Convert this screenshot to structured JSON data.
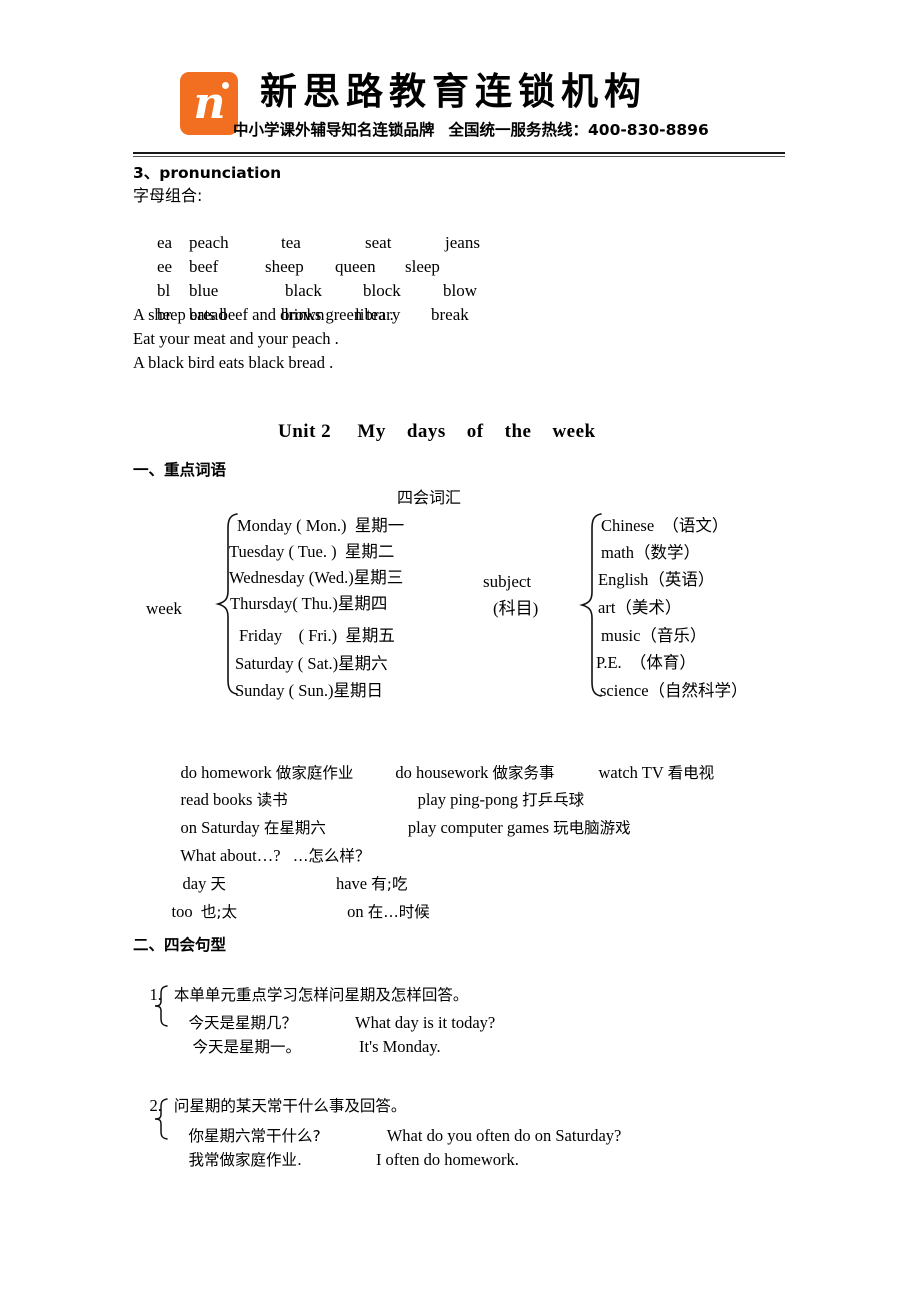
{
  "header": {
    "logo_icon": "script-n-logo-icon",
    "logo_letter": "n",
    "brand_title": "新思路教育连锁机构",
    "brand_sub_left": "中小学课外辅导知名连锁品牌",
    "brand_sub_right": "全国统一服务热线：400-830-8896"
  },
  "pronunciation": {
    "heading": "3、pronunciation",
    "subheading": "字母组合:",
    "rows": [
      {
        "combo": "ea",
        "words": [
          "peach",
          "tea",
          "seat",
          "jeans"
        ]
      },
      {
        "combo": "ee",
        "words": [
          "beef",
          "sheep",
          "queen",
          "sleep"
        ]
      },
      {
        "combo": "bl",
        "words": [
          "blue",
          "black",
          "block",
          "blow"
        ]
      },
      {
        "combo": "br",
        "words": [
          "bread",
          "brown",
          "library",
          "break"
        ]
      }
    ],
    "sentences": [
      "A sheep eats beef and drinks green tea .",
      "Eat your meat and your peach .",
      "A black bird eats black bread ."
    ]
  },
  "unit": {
    "title": "Unit 2     My    days    of    the    week",
    "section_one_heading": "一、重点词语",
    "vocab_heading": "四会词汇"
  },
  "week_group": {
    "label": "week",
    "items": [
      "Monday ( Mon.)  星期一",
      "Tuesday ( Tue. )  星期二",
      "Wednesday (Wed.)星期三",
      "Thursday( Thu.)星期四",
      "Friday    ( Fri.)  星期五",
      "Saturday ( Sat.)星期六",
      "Sunday ( Sun.)星期日"
    ]
  },
  "subject_group": {
    "label_en": "subject",
    "label_cn": "(科目)",
    "items": [
      "Chinese  （语文）",
      "math（数学）",
      "English（英语）",
      "art（美术）",
      "music（音乐）",
      "P.E.  （体育）",
      "science（自然科学）"
    ]
  },
  "phrases": {
    "lines": [
      [
        {
          "en": "do homework ",
          "zh": "做家庭作业"
        },
        {
          "en": "do housework ",
          "zh": "做家务事"
        },
        {
          "en": "watch TV ",
          "zh": "看电视"
        }
      ],
      [
        {
          "en": "read books ",
          "zh": "读书"
        },
        {
          "en": "play ping-pong ",
          "zh": "打乒乓球"
        }
      ],
      [
        {
          "en": "on Saturday ",
          "zh": "在星期六"
        },
        {
          "en": "play computer games ",
          "zh": "玩电脑游戏"
        }
      ],
      [
        {
          "en": "What about…?   ",
          "zh": "…怎么样？"
        }
      ],
      [
        {
          "en": "day ",
          "zh": "天"
        },
        {
          "en": "have ",
          "zh": "有;吃"
        }
      ],
      [
        {
          "en": "too  ",
          "zh": "也;太"
        },
        {
          "en": "on ",
          "zh": "在…时候"
        }
      ]
    ]
  },
  "sentence_patterns": {
    "section_heading": "二、四会句型",
    "items": [
      {
        "number": "1.",
        "desc": "本单单元重点学习怎样问星期及怎样回答。",
        "pairs": [
          {
            "zh": "今天是星期几？",
            "en": "What day is it today?"
          },
          {
            "zh": "今天是星期一。",
            "en": "It's Monday."
          }
        ]
      },
      {
        "number": "2.",
        "desc": "问星期的某天常干什么事及回答。",
        "pairs": [
          {
            "zh": "你星期六常干什么?",
            "en": "What do you often do on Saturday?"
          },
          {
            "zh": "我常做家庭作业.",
            "en": "I often do homework."
          }
        ]
      }
    ]
  },
  "colors": {
    "logo_orange": "#F26F21",
    "text": "#000000",
    "rule": "#1a1a1a"
  }
}
